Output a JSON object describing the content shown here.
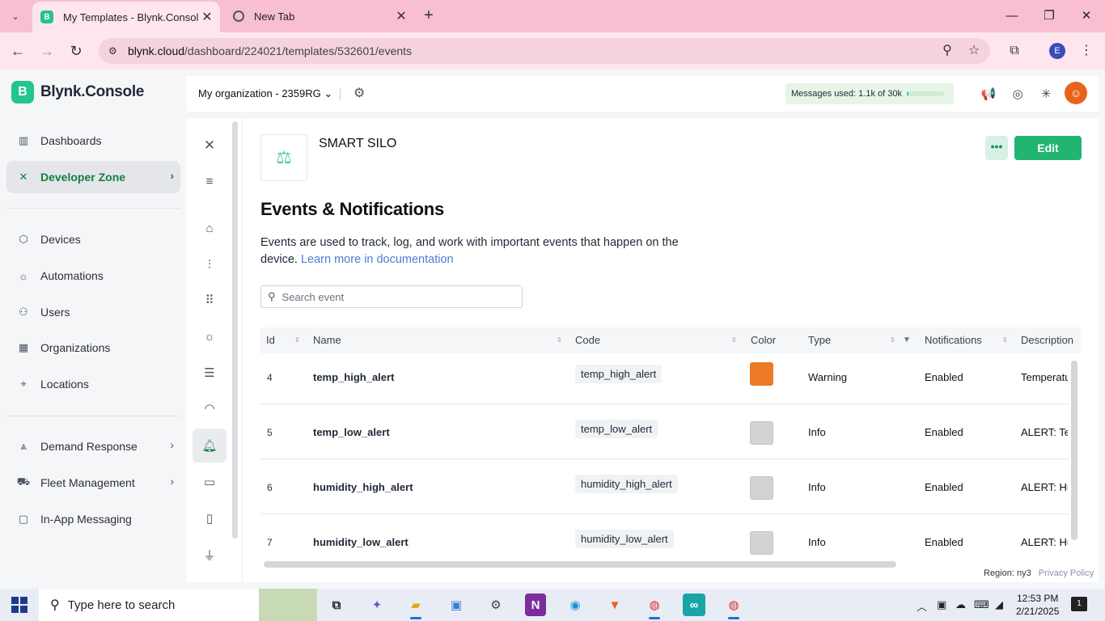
{
  "browser": {
    "tabs": [
      {
        "title": "My Templates - Blynk.Console",
        "favicon": "blynk-favicon",
        "favicon_letter": "B"
      },
      {
        "title": "New Tab",
        "favicon": "chrome-favicon"
      }
    ],
    "url_host": "blynk.cloud",
    "url_path": "/dashboard/224021/templates/532601/events",
    "profile_initial": "E"
  },
  "sidebar": {
    "brand_letter": "B",
    "brand_name": "Blynk.Console",
    "items": [
      {
        "label": "Dashboards",
        "icon": "bar-chart-icon"
      },
      {
        "label": "Developer Zone",
        "icon": "tools-icon",
        "active": true
      },
      {
        "label": "Devices",
        "icon": "cube-icon"
      },
      {
        "label": "Automations",
        "icon": "sun-icon"
      },
      {
        "label": "Users",
        "icon": "users-icon"
      },
      {
        "label": "Organizations",
        "icon": "building-icon"
      },
      {
        "label": "Locations",
        "icon": "pin-icon"
      },
      {
        "label": "Demand Response",
        "icon": "signal-icon"
      },
      {
        "label": "Fleet Management",
        "icon": "truck-icon"
      },
      {
        "label": "In-App Messaging",
        "icon": "message-icon"
      }
    ]
  },
  "header": {
    "organization": "My organization - 2359RG",
    "messages_used": "Messages used: 1.1k of 30k",
    "messages_fraction": 0.037
  },
  "template": {
    "name": "SMART SILO",
    "more_label": "•••",
    "edit_label": "Edit"
  },
  "page": {
    "title": "Events & Notifications",
    "description": "Events are used to track, log, and work with important events that happen on the device.",
    "link": "Learn more in documentation",
    "search_placeholder": "Search event"
  },
  "table": {
    "columns": [
      "Id",
      "Name",
      "Code",
      "Color",
      "Type",
      "Notifications",
      "Description"
    ],
    "rows": [
      {
        "id": "4",
        "name": "temp_high_alert",
        "code": "temp_high_alert",
        "color": "#ec7a26",
        "type": "Warning",
        "notifications": "Enabled",
        "description": "Temperatu"
      },
      {
        "id": "5",
        "name": "temp_low_alert",
        "code": "temp_low_alert",
        "color": "#d3d3d3",
        "type": "Info",
        "notifications": "Enabled",
        "description": "ALERT: Te"
      },
      {
        "id": "6",
        "name": "humidity_high_alert",
        "code": "humidity_high_alert",
        "color": "#d3d3d3",
        "type": "Info",
        "notifications": "Enabled",
        "description": "ALERT: Hu"
      },
      {
        "id": "7",
        "name": "humidity_low_alert",
        "code": "humidity_low_alert",
        "color": "#d3d3d3",
        "type": "Info",
        "notifications": "Enabled",
        "description": "ALERT: Hu"
      }
    ]
  },
  "footer": {
    "region": "Region: ny3",
    "privacy": "Privacy Policy"
  },
  "taskbar": {
    "search_text": "Type here to search",
    "time": "12:53 PM",
    "date": "2/21/2025",
    "notification_count": "1"
  },
  "colors": {
    "brand_green": "#23c48e",
    "edit_green": "#21b571",
    "active_nav_green": "#14803c",
    "tab_pink": "#f8bfd0"
  }
}
